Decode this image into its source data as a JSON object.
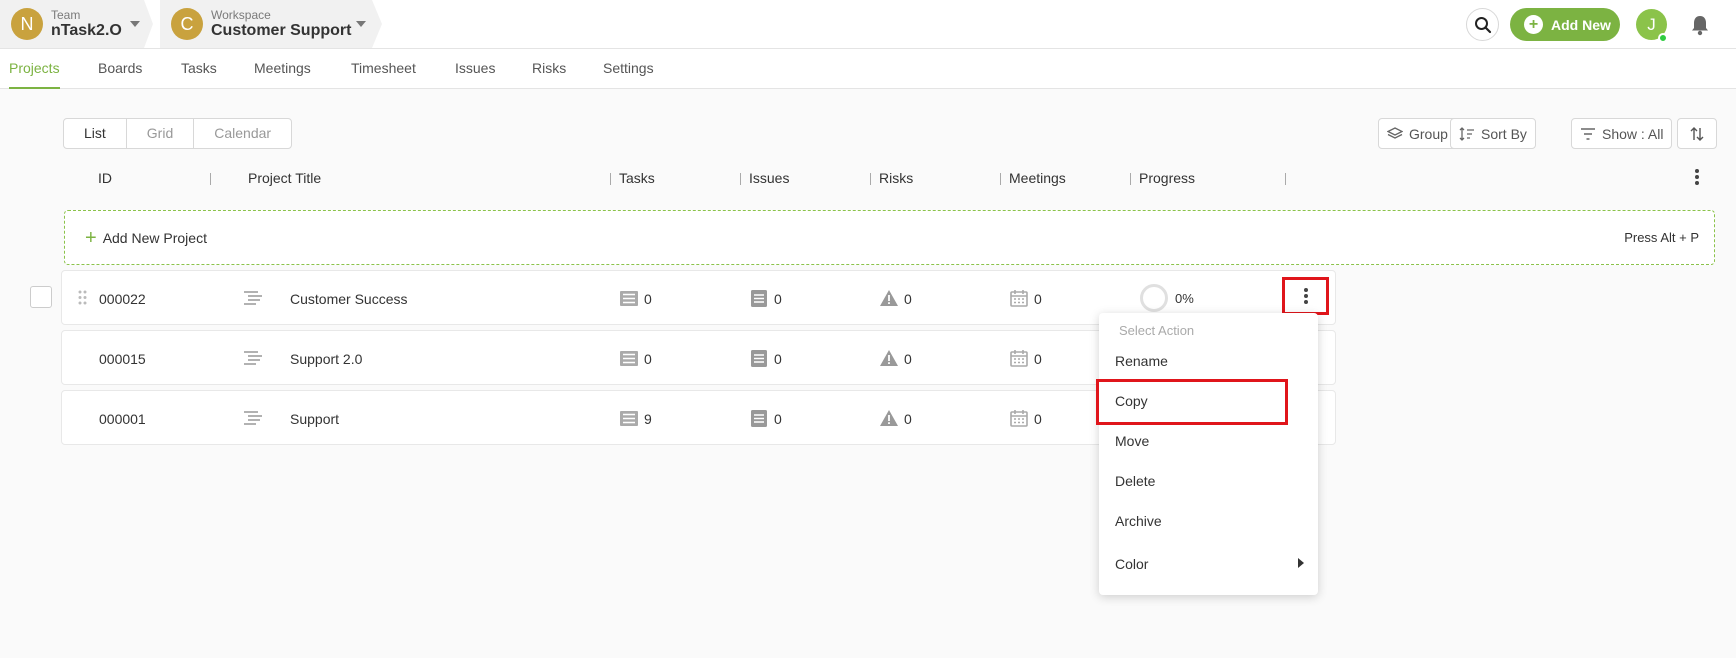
{
  "header": {
    "team": {
      "label": "Team",
      "name": "nTask2.O",
      "initial": "N"
    },
    "workspace": {
      "label": "Workspace",
      "name": "Customer Support",
      "initial": "C"
    },
    "add_new_label": "Add New",
    "user_initial": "J"
  },
  "tabs": [
    "Projects",
    "Boards",
    "Tasks",
    "Meetings",
    "Timesheet",
    "Issues",
    "Risks",
    "Settings"
  ],
  "active_tab": "Projects",
  "view_switch": {
    "options": [
      "List",
      "Grid",
      "Calendar"
    ],
    "active": "List"
  },
  "toolbar": {
    "group_by": "Group By",
    "sort_by": "Sort By",
    "show": "Show : All"
  },
  "columns": [
    "ID",
    "Project Title",
    "Tasks",
    "Issues",
    "Risks",
    "Meetings",
    "Progress"
  ],
  "add_project": {
    "label": "Add New Project",
    "hint": "Press Alt + P"
  },
  "rows": [
    {
      "id": "000022",
      "title": "Customer Success",
      "tasks": "0",
      "issues": "0",
      "risks": "0",
      "meetings": "0",
      "progress": "0%"
    },
    {
      "id": "000015",
      "title": "Support 2.0",
      "tasks": "0",
      "issues": "0",
      "risks": "0",
      "meetings": "0"
    },
    {
      "id": "000001",
      "title": "Support",
      "tasks": "9",
      "issues": "0",
      "risks": "0",
      "meetings": "0"
    }
  ],
  "menu": {
    "header": "Select Action",
    "items": [
      "Rename",
      "Copy",
      "Move",
      "Delete",
      "Archive",
      "Color"
    ]
  },
  "colors": {
    "accent": "#7cb342",
    "highlight": "#e0151b",
    "avatar": "#c9a23e"
  }
}
